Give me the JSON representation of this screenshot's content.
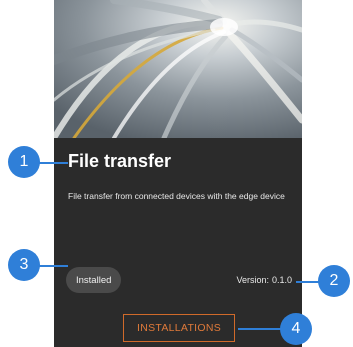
{
  "app": {
    "title": "File transfer",
    "description": "File transfer from connected devices with the edge device",
    "status_badge": "Installed",
    "version_label": "Version:",
    "version_value": "0.1.0",
    "installations_button": "INSTALLATIONS"
  },
  "hero_image": {
    "icon": "tunnel-light-streaks-image"
  },
  "callouts": [
    "1",
    "2",
    "3",
    "4"
  ],
  "colors": {
    "card_background": "#2b2b2b",
    "badge_background": "#4a4a4a",
    "accent_orange": "#e07a3a",
    "callout_blue": "#2f7fd8"
  }
}
